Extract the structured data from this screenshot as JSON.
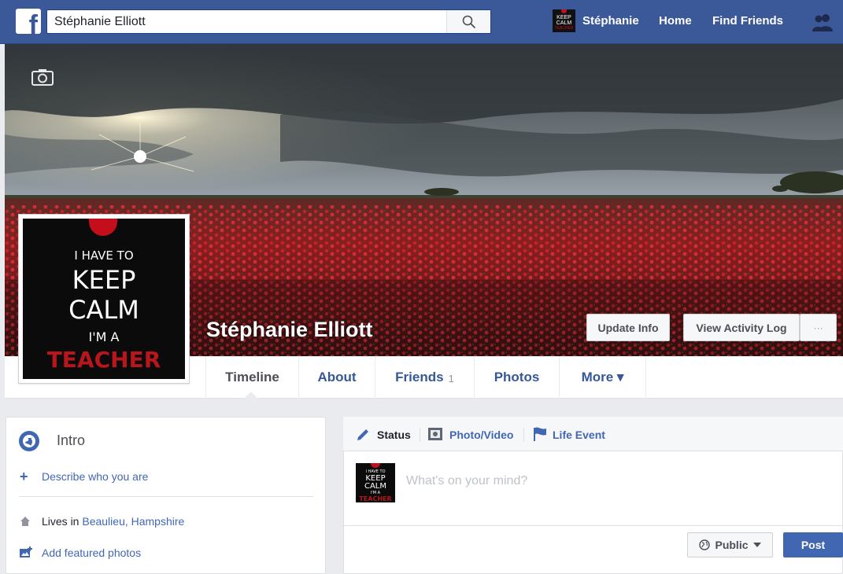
{
  "topbar": {
    "search_value": "Stéphanie Elliott",
    "user_name": "Stéphanie",
    "home_label": "Home",
    "find_friends_label": "Find Friends",
    "brand_color": "#3b5998"
  },
  "profile": {
    "name": "Stéphanie Elliott",
    "picture_lines": [
      "I HAVE TO",
      "KEEP",
      "CALM",
      "I'M A",
      "TEACHER"
    ],
    "buttons": {
      "update_info": "Update Info",
      "view_activity_log": "View Activity Log",
      "more_dots": "···"
    }
  },
  "tabs": [
    {
      "label": "Timeline"
    },
    {
      "label": "About"
    },
    {
      "label": "Friends",
      "count": "1"
    },
    {
      "label": "Photos"
    },
    {
      "label": "More ▾"
    }
  ],
  "intro": {
    "title": "Intro",
    "describe_link": "Describe who you are",
    "lives_prefix": "Lives in",
    "lives_place": "Beaulieu, Hampshire",
    "featured_link": "Add featured photos"
  },
  "composer": {
    "status_label": "Status",
    "photo_video_label": "Photo/Video",
    "life_event_label": "Life Event",
    "placeholder": "What's on your mind?",
    "public_label": "Public",
    "post_label": "Post"
  },
  "icons": [
    "facebook-logo",
    "search-icon",
    "friend-requests-icon",
    "camera-icon",
    "globe-icon",
    "plus-icon",
    "home-icon",
    "photo-add-icon",
    "pencil-icon",
    "photo-icon",
    "flag-icon",
    "public-globe-icon",
    "caret-down-icon"
  ]
}
